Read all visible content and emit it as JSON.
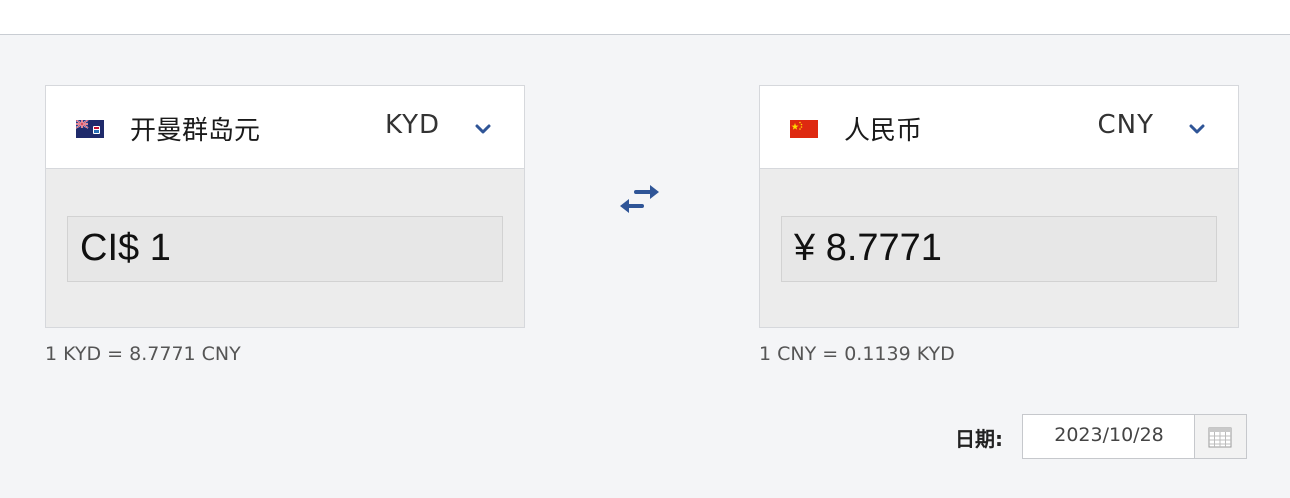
{
  "from": {
    "name": "开曼群岛元",
    "code": "KYD",
    "amount": "CI$ 1",
    "rate": "1 KYD = 8.7771 CNY",
    "flag_icon": "cayman-islands-flag-icon"
  },
  "to": {
    "name": "人民币",
    "code": "CNY",
    "amount": "¥ 8.7771",
    "rate": "1 CNY = 0.1139 KYD",
    "flag_icon": "china-flag-icon"
  },
  "date": {
    "label": "日期:",
    "value": "2023/10/28"
  },
  "colors": {
    "accent": "#2f5597",
    "china_red": "#de2910",
    "cayman_blue": "#1f2a6b"
  }
}
